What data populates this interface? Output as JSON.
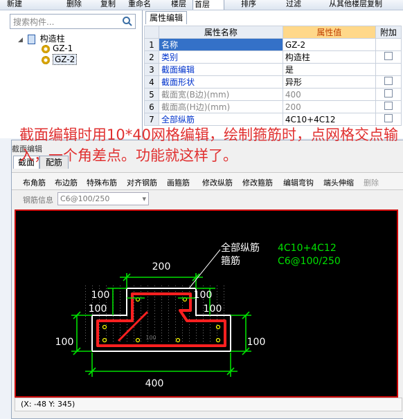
{
  "toolbar": {
    "items": [
      "新建",
      "删除",
      "复制",
      "重命名",
      "楼层",
      "首层",
      "排序",
      "过滤",
      "从其他楼层复制"
    ]
  },
  "search": {
    "placeholder": "搜索构件..."
  },
  "tree": {
    "root": "构造柱",
    "items": [
      "GZ-1",
      "GZ-2"
    ],
    "selected_index": 1
  },
  "props": {
    "tab": "属性编辑",
    "headers": {
      "name": "属性名称",
      "value": "属性值",
      "extra": "附加"
    },
    "rows": [
      {
        "num": "1",
        "name": "名称",
        "value": "GZ-2",
        "checkbox": false
      },
      {
        "num": "2",
        "name": "类别",
        "value": "构造柱",
        "checkbox": true
      },
      {
        "num": "3",
        "name": "截面编辑",
        "value": "是",
        "checkbox": false
      },
      {
        "num": "4",
        "name": "截面形状",
        "value": "异形",
        "checkbox": true
      },
      {
        "num": "5",
        "name": "截面宽(B边)(mm)",
        "value": "400",
        "checkbox": true
      },
      {
        "num": "6",
        "name": "截面高(H边)(mm)",
        "value": "200",
        "checkbox": true
      },
      {
        "num": "7",
        "name": "全部纵筋",
        "value": "4C10+4C12",
        "checkbox": true
      }
    ]
  },
  "editor": {
    "title": "截面编辑",
    "tabs": [
      "截面",
      "配筋"
    ],
    "tools": [
      "布角筋",
      "布边筋",
      "特殊布筋",
      "对齐钢筋",
      "画箍筋",
      "修改纵筋",
      "修改箍筋",
      "编辑弯钩",
      "端头伸缩",
      "删除"
    ],
    "rebar_label": "钢筋信息",
    "rebar_value": "C6@100/250"
  },
  "drawing": {
    "legend_long": "全部纵筋",
    "legend_long_value": "4C10+4C12",
    "legend_stirrup": "箍筋",
    "legend_stirrup_value": "C6@100/250",
    "dims": {
      "top": "200",
      "left_upper": "100",
      "right_upper": "100",
      "inner_left": "100",
      "inner_right": "100",
      "left": "100",
      "right": "100",
      "bottom": "400"
    },
    "grid_label": "100"
  },
  "status": {
    "coords": "(X: -48 Y: 345)"
  },
  "overlay_text": "截面编辑时用10*40网格编辑，绘制箍筋时，点网格交点输入，一个角差点。功能就这样了。",
  "colors": {
    "accent": "#3471c8",
    "dim": "#00e000",
    "stirrup": "#ff2020",
    "overlay": "#e03030"
  }
}
